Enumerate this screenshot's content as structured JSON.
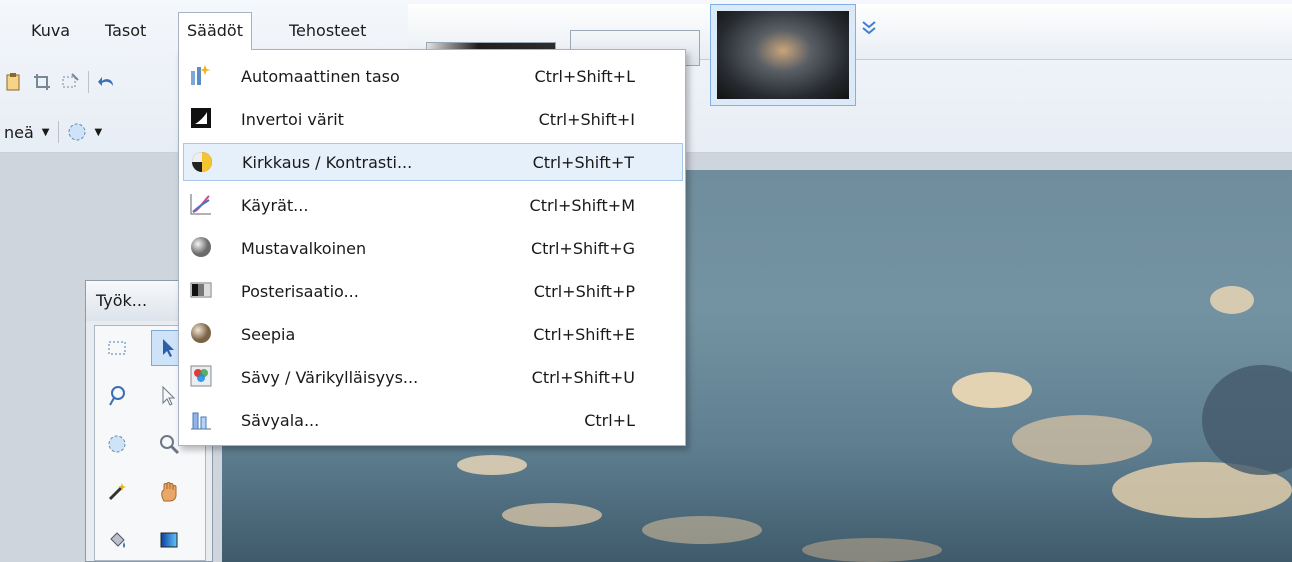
{
  "menubar": [
    {
      "label": "Kuva"
    },
    {
      "label": "Tasot"
    },
    {
      "label": "Säädöt"
    },
    {
      "label": "Tehosteet"
    }
  ],
  "toolbar": {
    "selection_mode": "neä"
  },
  "dropdown": {
    "items": [
      {
        "label": "Automaattinen taso",
        "shortcut": "Ctrl+Shift+L",
        "icon": "auto-level-icon"
      },
      {
        "label": "Invertoi värit",
        "shortcut": "Ctrl+Shift+I",
        "icon": "invert-colors-icon"
      },
      {
        "label": "Kirkkaus / Kontrasti...",
        "shortcut": "Ctrl+Shift+T",
        "icon": "brightness-contrast-icon",
        "highlighted": true
      },
      {
        "label": "Käyrät...",
        "shortcut": "Ctrl+Shift+M",
        "icon": "curves-icon"
      },
      {
        "label": "Mustavalkoinen",
        "shortcut": "Ctrl+Shift+G",
        "icon": "black-white-icon"
      },
      {
        "label": "Posterisaatio...",
        "shortcut": "Ctrl+Shift+P",
        "icon": "posterize-icon"
      },
      {
        "label": "Seepia",
        "shortcut": "Ctrl+Shift+E",
        "icon": "sepia-icon"
      },
      {
        "label": "Sävy / Värikylläisyys...",
        "shortcut": "Ctrl+Shift+U",
        "icon": "hue-saturation-icon"
      },
      {
        "label": "Sävyala...",
        "shortcut": "Ctrl+L",
        "icon": "levels-icon"
      }
    ]
  },
  "tools_window": {
    "title": "Työk..."
  },
  "colors": {
    "menu_highlight": "#e6f0fa",
    "menu_border": "#a7b3c2",
    "accent": "#3d7fd1"
  }
}
